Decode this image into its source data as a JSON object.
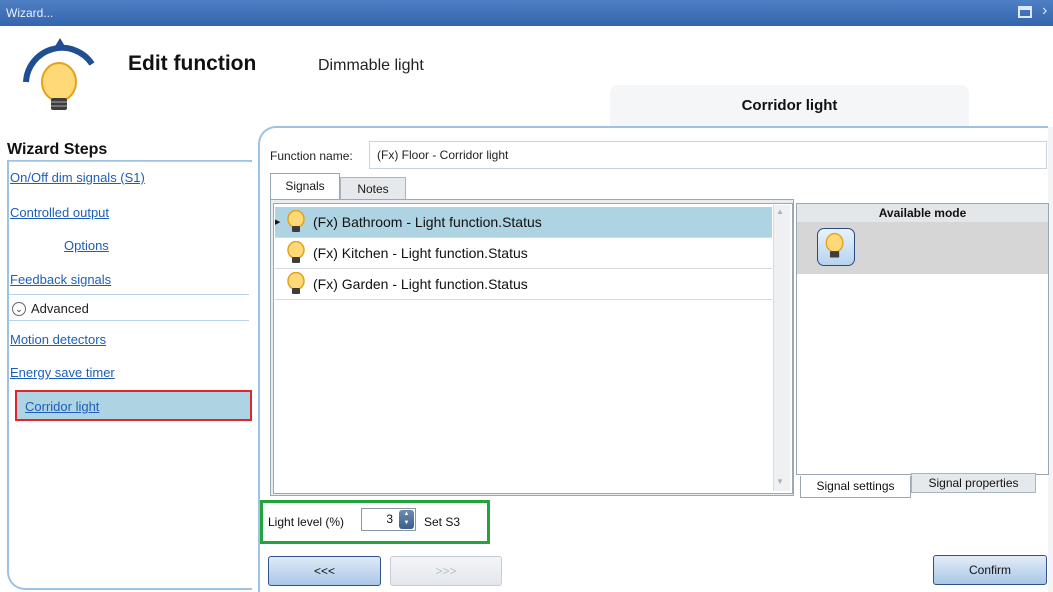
{
  "window": {
    "title": "Wizard..."
  },
  "header": {
    "title": "Edit function",
    "subtitle": "Dimmable light",
    "active_tab": "Corridor light"
  },
  "sidebar": {
    "heading": "Wizard Steps",
    "items": [
      {
        "label": "On/Off dim signals (S1)"
      },
      {
        "label": "Controlled output"
      },
      {
        "label": "Options"
      },
      {
        "label": "Feedback signals"
      },
      {
        "label": "Advanced"
      },
      {
        "label": "Motion detectors"
      },
      {
        "label": "Energy save timer"
      },
      {
        "label": "Corridor light",
        "selected": true
      }
    ]
  },
  "function_name": {
    "label": "Function name:",
    "value": "(Fx) Floor - Corridor light"
  },
  "tabs": [
    {
      "label": "Signals",
      "active": true
    },
    {
      "label": "Notes"
    }
  ],
  "signals": [
    {
      "label": "(Fx) Bathroom - Light function.Status",
      "selected": true
    },
    {
      "label": "(Fx) Kitchen - Light function.Status"
    },
    {
      "label": "(Fx) Garden - Light function.Status"
    }
  ],
  "available_mode": {
    "header": "Available mode",
    "icon": "lightbulb-icon"
  },
  "bottom_tabs": [
    {
      "label": "Signal settings",
      "active": true
    },
    {
      "label": "Signal properties"
    }
  ],
  "light_level": {
    "label": "Light level (%)",
    "value": "3",
    "set_label": "Set S3"
  },
  "buttons": {
    "back": "<<<",
    "next": ">>>",
    "confirm": "Confirm"
  },
  "colors": {
    "titlebar": "#3a6bb4",
    "link": "#1d5fb8",
    "selection": "#aed3e3",
    "highlight_red": "#e0262b",
    "highlight_green": "#22a33b"
  }
}
